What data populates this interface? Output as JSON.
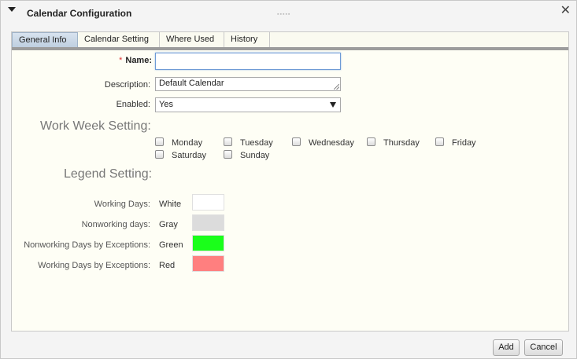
{
  "dialog": {
    "title": "Calendar Configuration",
    "grip": "▪▪▪▪▪",
    "close_glyph": "✕"
  },
  "tabs": [
    {
      "label": "General Info",
      "active": true
    },
    {
      "label": "Calendar Setting",
      "active": false
    },
    {
      "label": "Where Used",
      "active": false
    },
    {
      "label": "History",
      "active": false
    }
  ],
  "form": {
    "name_required_marker": "*",
    "name_label": "Name:",
    "name_value": "",
    "description_label": "Description:",
    "description_value": "Default Calendar",
    "enabled_label": "Enabled:",
    "enabled_value": "Yes"
  },
  "work_week": {
    "title": "Work Week Setting:",
    "days": [
      {
        "label": "Monday",
        "checked": false
      },
      {
        "label": "Tuesday",
        "checked": false
      },
      {
        "label": "Wednesday",
        "checked": false
      },
      {
        "label": "Thursday",
        "checked": false
      },
      {
        "label": "Friday",
        "checked": false
      },
      {
        "label": "Saturday",
        "checked": false
      },
      {
        "label": "Sunday",
        "checked": false
      }
    ]
  },
  "legend": {
    "title": "Legend Setting:",
    "items": [
      {
        "label": "Working Days:",
        "value": "White",
        "color": "#ffffff"
      },
      {
        "label": "Nonworking days:",
        "value": "Gray",
        "color": "#dcdcdc"
      },
      {
        "label": "Nonworking Days by Exceptions:",
        "value": "Green",
        "color": "#1aff1a"
      },
      {
        "label": "Working Days by Exceptions:",
        "value": "Red",
        "color": "#ff7f7f"
      }
    ]
  },
  "buttons": {
    "add": "Add",
    "cancel": "Cancel"
  }
}
